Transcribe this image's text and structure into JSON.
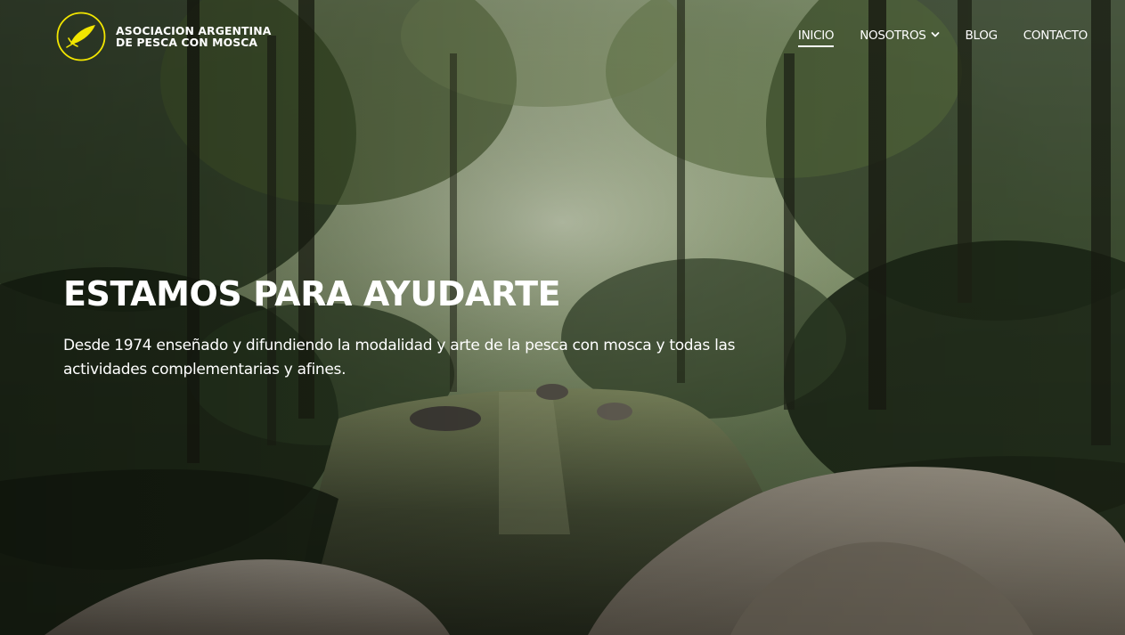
{
  "brand": {
    "name_line1": "ASOCIACION ARGENTINA",
    "name_line2": "DE PESCA CON MOSCA",
    "logo_icon": "fly-feather-icon",
    "logo_color": "#f2e600"
  },
  "nav": {
    "items": [
      {
        "label": "INICIO",
        "active": true
      },
      {
        "label": "NOSOTROS",
        "has_dropdown": true
      },
      {
        "label": "BLOG"
      },
      {
        "label": "CONTACTO"
      }
    ]
  },
  "hero": {
    "title": "ESTAMOS PARA AYUDARTE",
    "text": "Desde 1974 enseñado y difundiendo la modalidad y arte de la pesca con mosca y todas las actividades complementarias y afines.",
    "background": "forest-stream-with-rocks"
  },
  "colors": {
    "text": "#ffffff",
    "accent": "#f2e600"
  }
}
